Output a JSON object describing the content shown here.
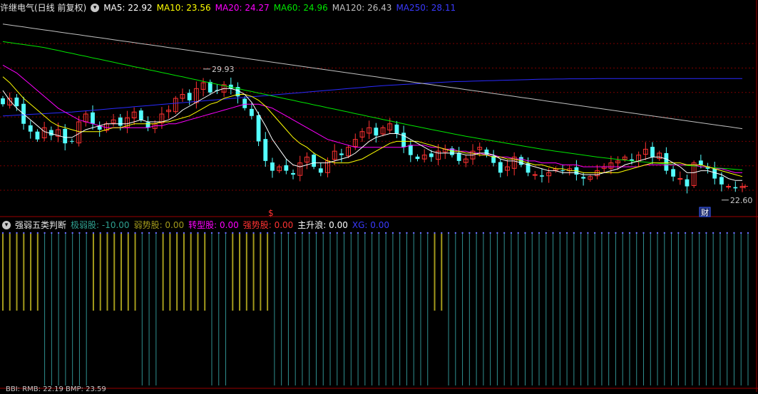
{
  "colors": {
    "up": "#ff3232",
    "down": "#54ffff",
    "ma5": "#ffffff",
    "ma10": "#ffff00",
    "ma20": "#ff00ff",
    "ma60": "#00e600",
    "ma120": "#c0c0c0",
    "ma250": "#2a2aff",
    "grid": "#7a0000",
    "bar_olive": "#a39a1c",
    "bar_teal": "#2f8f8f"
  },
  "main_header": {
    "title": "许继电气(日线 前复权)",
    "ma": [
      {
        "label": "MA5: 22.92",
        "color": "#ffffff"
      },
      {
        "label": "MA10: 23.56",
        "color": "#ffff00"
      },
      {
        "label": "MA20: 24.27",
        "color": "#ff00ff"
      },
      {
        "label": "MA60: 24.96",
        "color": "#00e600"
      },
      {
        "label": "MA120: 26.43",
        "color": "#c0c0c0"
      },
      {
        "label": "MA250: 28.11",
        "color": "#3a3aff"
      }
    ]
  },
  "sub_header": {
    "title": "强弱五类判断",
    "items": [
      {
        "label": "极弱股: -10.00",
        "color": "#2fa090"
      },
      {
        "label": "弱势股: 0.00",
        "color": "#a39a1c"
      },
      {
        "label": "转型股: 0.00",
        "color": "#ff00ff"
      },
      {
        "label": "强势股: 0.00",
        "color": "#ff3232"
      },
      {
        "label": "主升浪: 0.00",
        "color": "#ffffff"
      },
      {
        "label": "XG: 0.00",
        "color": "#3a3aff"
      }
    ]
  },
  "bottom_header": "BBI: RMB: 22.19 BMP: 23.59",
  "annotations": {
    "high_label": "29.93",
    "low_label": "22.60",
    "dollar_mark": "$",
    "event_badge": "财"
  },
  "chart_data": [
    {
      "type": "candlestick",
      "ylim": [
        21.2,
        31.4
      ],
      "gridlines": [
        29.9,
        28.65,
        27.4,
        26.15,
        24.9,
        23.65,
        22.4
      ],
      "closes": [
        26.8,
        27.1,
        26.7,
        25.8,
        25.4,
        25.0,
        25.6,
        25.2,
        25.5,
        24.8,
        24.9,
        25.9,
        26.3,
        25.8,
        25.5,
        25.8,
        26.0,
        25.7,
        26.1,
        26.4,
        26.0,
        25.6,
        25.8,
        26.3,
        26.5,
        27.1,
        27.3,
        27.0,
        27.6,
        27.9,
        27.4,
        27.5,
        27.8,
        27.6,
        27.2,
        26.6,
        26.2,
        24.9,
        23.9,
        23.4,
        23.6,
        23.4,
        23.2,
        23.8,
        24.1,
        23.6,
        23.3,
        23.9,
        24.4,
        24.2,
        24.6,
        25.0,
        25.4,
        25.6,
        25.2,
        25.6,
        25.8,
        25.3,
        24.6,
        24.2,
        24.0,
        24.2,
        24.1,
        24.4,
        24.5,
        24.2,
        23.9,
        24.0,
        24.4,
        24.6,
        24.2,
        23.8,
        23.3,
        23.6,
        24.1,
        23.7,
        23.3,
        23.2,
        23.1,
        23.3,
        23.5,
        23.4,
        23.5,
        23.2,
        23.0,
        23.1,
        23.4,
        23.6,
        23.8,
        23.9,
        24.1,
        23.9,
        24.2,
        24.5,
        24.1,
        24.3,
        23.4,
        23.1,
        23.0,
        22.6,
        23.8,
        23.7,
        23.5,
        23.0,
        22.7,
        22.6,
        22.5,
        22.6
      ],
      "ma5": [
        27.5,
        27.0,
        26.6,
        26.3,
        26.0,
        25.7,
        25.4,
        25.3,
        25.2,
        25.1,
        25.1,
        25.3,
        25.5,
        25.6,
        25.7,
        25.8,
        25.8,
        25.8,
        25.8,
        25.9,
        26.0,
        25.9,
        25.9,
        25.9,
        26.0,
        26.2,
        26.5,
        26.7,
        26.9,
        27.1,
        27.3,
        27.5,
        27.6,
        27.6,
        27.5,
        27.3,
        26.9,
        26.3,
        25.7,
        25.0,
        24.5,
        24.0,
        23.7,
        23.6,
        23.7,
        23.8,
        23.8,
        23.8,
        23.9,
        24.0,
        24.1,
        24.3,
        24.6,
        24.9,
        25.1,
        25.2,
        25.3,
        25.3,
        25.2,
        25.0,
        24.8,
        24.6,
        24.4,
        24.3,
        24.3,
        24.3,
        24.3,
        24.2,
        24.2,
        24.3,
        24.3,
        24.2,
        24.0,
        23.9,
        23.9,
        23.8,
        23.7,
        23.6,
        23.5,
        23.4,
        23.4,
        23.3,
        23.3,
        23.3,
        23.2,
        23.2,
        23.2,
        23.3,
        23.4,
        23.5,
        23.7,
        23.8,
        23.9,
        24.0,
        24.1,
        24.1,
        24.0,
        23.8,
        23.6,
        23.3,
        23.3,
        23.4,
        23.4,
        23.3,
        23.2,
        23.0,
        22.9,
        22.9
      ],
      "ma10": [
        28.2,
        27.9,
        27.5,
        27.1,
        26.8,
        26.5,
        26.2,
        25.9,
        25.7,
        25.6,
        25.5,
        25.4,
        25.4,
        25.4,
        25.4,
        25.5,
        25.6,
        25.6,
        25.7,
        25.8,
        25.8,
        25.8,
        25.8,
        25.9,
        25.9,
        26.0,
        26.1,
        26.2,
        26.4,
        26.6,
        26.8,
        26.9,
        27.1,
        27.2,
        27.3,
        27.3,
        27.2,
        27.0,
        26.7,
        26.3,
        25.9,
        25.5,
        25.1,
        24.8,
        24.6,
        24.3,
        24.1,
        23.9,
        23.8,
        23.8,
        23.8,
        23.9,
        24.0,
        24.2,
        24.4,
        24.6,
        24.8,
        24.9,
        24.9,
        24.9,
        24.9,
        24.8,
        24.7,
        24.6,
        24.5,
        24.4,
        24.4,
        24.3,
        24.3,
        24.2,
        24.2,
        24.1,
        24.1,
        24.0,
        24.0,
        23.9,
        23.8,
        23.7,
        23.7,
        23.6,
        23.5,
        23.5,
        23.4,
        23.4,
        23.3,
        23.3,
        23.3,
        23.3,
        23.3,
        23.3,
        23.4,
        23.5,
        23.6,
        23.7,
        23.8,
        23.8,
        23.8,
        23.8,
        23.8,
        23.7,
        23.7,
        23.7,
        23.6,
        23.5,
        23.4,
        23.3,
        23.2,
        23.1
      ],
      "ma20": [
        28.8,
        28.6,
        28.4,
        28.1,
        27.8,
        27.5,
        27.2,
        26.9,
        26.6,
        26.4,
        26.2,
        26.0,
        25.9,
        25.8,
        25.7,
        25.6,
        25.6,
        25.6,
        25.6,
        25.6,
        25.6,
        25.6,
        25.7,
        25.7,
        25.8,
        25.8,
        25.9,
        26.0,
        26.1,
        26.2,
        26.3,
        26.4,
        26.5,
        26.6,
        26.7,
        26.8,
        26.8,
        26.8,
        26.7,
        26.6,
        26.4,
        26.2,
        26.0,
        25.8,
        25.6,
        25.4,
        25.2,
        25.0,
        24.9,
        24.8,
        24.7,
        24.6,
        24.6,
        24.6,
        24.6,
        24.6,
        24.6,
        24.6,
        24.6,
        24.7,
        24.7,
        24.7,
        24.6,
        24.6,
        24.5,
        24.5,
        24.4,
        24.4,
        24.3,
        24.3,
        24.2,
        24.2,
        24.1,
        24.1,
        24.0,
        24.0,
        23.9,
        23.9,
        23.8,
        23.8,
        23.8,
        23.7,
        23.7,
        23.7,
        23.6,
        23.6,
        23.6,
        23.6,
        23.6,
        23.6,
        23.6,
        23.6,
        23.6,
        23.7,
        23.7,
        23.7,
        23.7,
        23.7,
        23.7,
        23.7,
        23.7,
        23.6,
        23.6,
        23.5,
        23.5,
        23.4,
        23.3,
        23.3
      ],
      "ma60": [
        30.0,
        29.95,
        29.9,
        29.85,
        29.8,
        29.75,
        29.7,
        29.62,
        29.55,
        29.47,
        29.4,
        29.32,
        29.25,
        29.17,
        29.1,
        29.02,
        28.95,
        28.87,
        28.8,
        28.72,
        28.65,
        28.57,
        28.5,
        28.42,
        28.35,
        28.27,
        28.2,
        28.12,
        28.05,
        27.97,
        27.9,
        27.82,
        27.75,
        27.67,
        27.6,
        27.52,
        27.45,
        27.37,
        27.3,
        27.22,
        27.15,
        27.07,
        27.0,
        26.92,
        26.85,
        26.77,
        26.7,
        26.62,
        26.55,
        26.47,
        26.4,
        26.32,
        26.25,
        26.17,
        26.1,
        26.02,
        25.95,
        25.87,
        25.8,
        25.72,
        25.65,
        25.58,
        25.51,
        25.44,
        25.37,
        25.3,
        25.23,
        25.16,
        25.1,
        25.04,
        24.98,
        24.92,
        24.86,
        24.8,
        24.74,
        24.68,
        24.62,
        24.56,
        24.5,
        24.45,
        24.4,
        24.35,
        24.3,
        24.25,
        24.2,
        24.15,
        24.1,
        24.06,
        24.02,
        23.98,
        23.94,
        23.9,
        23.87,
        23.84,
        23.81,
        23.78,
        23.75,
        23.72,
        23.7,
        23.67,
        23.64,
        23.61,
        23.58,
        23.55,
        23.52,
        23.5,
        23.47,
        23.44
      ],
      "ma120": [
        30.9,
        30.85,
        30.8,
        30.75,
        30.7,
        30.65,
        30.6,
        30.55,
        30.5,
        30.45,
        30.4,
        30.35,
        30.3,
        30.25,
        30.2,
        30.15,
        30.1,
        30.05,
        30.0,
        29.95,
        29.9,
        29.85,
        29.8,
        29.75,
        29.7,
        29.65,
        29.6,
        29.55,
        29.5,
        29.45,
        29.4,
        29.35,
        29.3,
        29.25,
        29.2,
        29.15,
        29.1,
        29.05,
        29.0,
        28.95,
        28.9,
        28.85,
        28.8,
        28.75,
        28.7,
        28.65,
        28.6,
        28.55,
        28.5,
        28.45,
        28.4,
        28.35,
        28.3,
        28.25,
        28.2,
        28.15,
        28.1,
        28.05,
        28.0,
        27.95,
        27.9,
        27.85,
        27.8,
        27.75,
        27.7,
        27.65,
        27.6,
        27.55,
        27.5,
        27.45,
        27.4,
        27.35,
        27.3,
        27.25,
        27.2,
        27.15,
        27.1,
        27.05,
        27.0,
        26.95,
        26.9,
        26.85,
        26.8,
        26.75,
        26.7,
        26.65,
        26.6,
        26.55,
        26.5,
        26.45,
        26.4,
        26.35,
        26.3,
        26.25,
        26.2,
        26.15,
        26.1,
        26.05,
        26.0,
        25.95,
        25.9,
        25.85,
        25.8,
        25.75,
        25.7,
        25.65,
        25.6,
        25.55
      ],
      "ma250": [
        26.2,
        26.22,
        26.24,
        26.26,
        26.28,
        26.3,
        26.32,
        26.34,
        26.36,
        26.38,
        26.4,
        26.43,
        26.46,
        26.49,
        26.52,
        26.55,
        26.58,
        26.61,
        26.64,
        26.67,
        26.7,
        26.73,
        26.76,
        26.79,
        26.82,
        26.85,
        26.88,
        26.91,
        26.94,
        26.97,
        27.0,
        27.03,
        27.06,
        27.09,
        27.12,
        27.15,
        27.18,
        27.21,
        27.24,
        27.27,
        27.3,
        27.33,
        27.36,
        27.39,
        27.42,
        27.45,
        27.48,
        27.51,
        27.54,
        27.57,
        27.6,
        27.63,
        27.66,
        27.69,
        27.72,
        27.75,
        27.77,
        27.79,
        27.81,
        27.83,
        27.85,
        27.87,
        27.89,
        27.91,
        27.93,
        27.95,
        27.96,
        27.97,
        27.98,
        27.99,
        28.0,
        28.01,
        28.02,
        28.03,
        28.04,
        28.05,
        28.06,
        28.07,
        28.08,
        28.08,
        28.09,
        28.09,
        28.1,
        28.1,
        28.1,
        28.1,
        28.11,
        28.11,
        28.11,
        28.11,
        28.11,
        28.11,
        28.11,
        28.11,
        28.11,
        28.11,
        28.11,
        28.11,
        28.11,
        28.11,
        28.11,
        28.11,
        28.11,
        28.11,
        28.11,
        28.11,
        28.11,
        28.11
      ]
    },
    {
      "type": "bar",
      "title": "强弱五类判断",
      "ylim": [
        -10,
        0
      ],
      "olive_index_ranges": [
        [
          0,
          5
        ],
        [
          13,
          19
        ],
        [
          23,
          29
        ],
        [
          33,
          38
        ],
        [
          62,
          63
        ]
      ],
      "values_note_free": true
    }
  ]
}
